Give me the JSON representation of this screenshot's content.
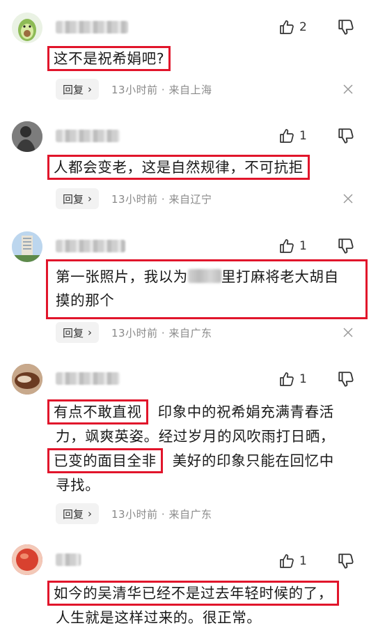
{
  "comments": [
    {
      "likes": "2",
      "text": "这不是祝希娟吧?",
      "reply": "回复",
      "time": "13小时前",
      "location": "来自上海"
    },
    {
      "likes": "1",
      "text": "人都会变老，这是自然规律，不可抗拒",
      "reply": "回复",
      "time": "13小时前",
      "location": "来自辽宁"
    },
    {
      "likes": "1",
      "text_a": "第一张照片，我以为",
      "text_b": "里打麻将老大胡自",
      "text_c": "摸的那个",
      "reply": "回复",
      "time": "13小时前",
      "location": "来自广东"
    },
    {
      "likes": "1",
      "hl1": "有点不敢直视",
      "rest1": "印象中的祝希娟充满青春活",
      "line2": "力，飒爽英姿。经过岁月的风吹雨打日晒，",
      "hl2": "已变的面目全非",
      "rest2": "美好的印象只能在回忆中",
      "line4": "寻找。",
      "reply": "回复",
      "time": "13小时前",
      "location": "来自广东"
    },
    {
      "likes": "1",
      "text": "如今的吴清华已经不是过去年轻时候的了，",
      "line2": "人生就是这样过来的。很正常。"
    }
  ],
  "meta_separator": "·"
}
